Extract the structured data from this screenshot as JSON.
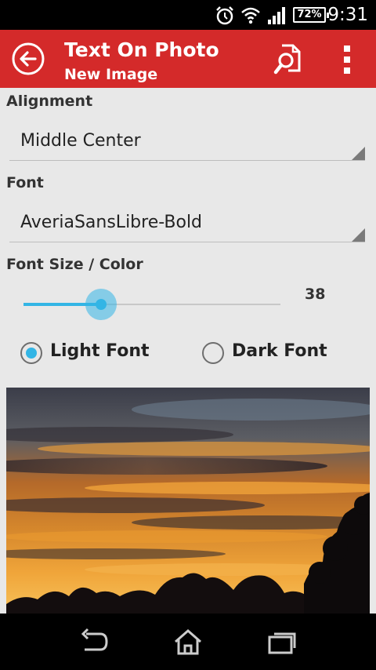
{
  "status_bar": {
    "time": "9:31",
    "battery": "72%",
    "icons": [
      "alarm-icon",
      "wifi-icon",
      "signal-icon",
      "battery-icon"
    ]
  },
  "action_bar": {
    "title": "Text On Photo",
    "subtitle": "New Image",
    "color": "#d42a2a",
    "icons": [
      "back-arrow-icon",
      "search-file-icon",
      "overflow-menu-icon"
    ]
  },
  "form": {
    "alignment": {
      "label": "Alignment",
      "value": "Middle Center"
    },
    "font": {
      "label": "Font",
      "value": "AveriaSansLibre-Bold"
    },
    "font_size": {
      "label": "Font Size / Color",
      "value": "38",
      "slider_fraction": 0.3
    },
    "font_color": {
      "options": [
        {
          "label": "Light Font",
          "selected": true
        },
        {
          "label": "Dark Font",
          "selected": false
        }
      ]
    },
    "accent_color": "#33b5e5"
  },
  "preview": {
    "icon": "sunset-photo"
  },
  "nav_bar": {
    "icons": [
      "back-icon",
      "home-icon",
      "recent-apps-icon"
    ]
  }
}
